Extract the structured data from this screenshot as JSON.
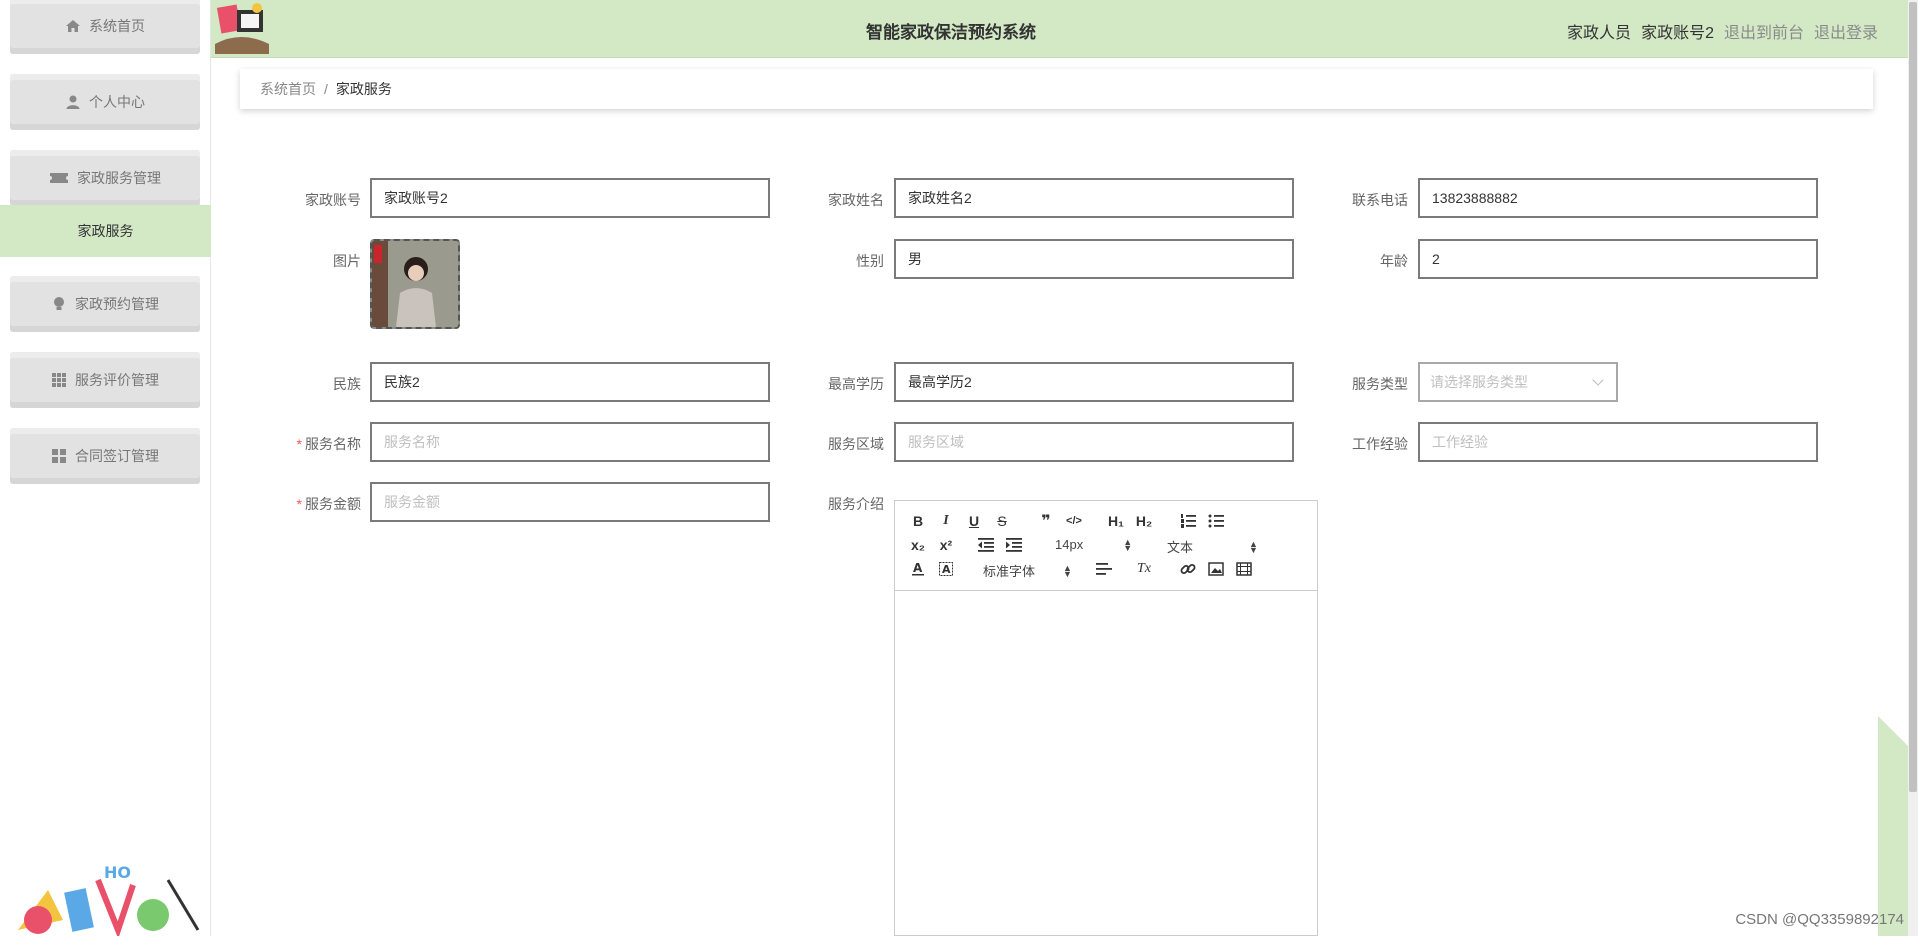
{
  "app": {
    "title": "智能家政保洁预约系统"
  },
  "header": {
    "role": "家政人员",
    "account": "家政账号2",
    "to_front": "退出到前台",
    "logout": "退出登录"
  },
  "sidebar": {
    "items": [
      {
        "label": "系统首页",
        "icon": "home-icon"
      },
      {
        "label": "个人中心",
        "icon": "user-icon"
      },
      {
        "label": "家政服务管理",
        "icon": "ticket-icon"
      },
      {
        "label": "家政预约管理",
        "icon": "bulb-icon"
      },
      {
        "label": "服务评价管理",
        "icon": "grid-icon"
      },
      {
        "label": "合同签订管理",
        "icon": "apps-icon"
      }
    ],
    "active_sub": "家政服务"
  },
  "breadcrumb": {
    "home": "系统首页",
    "sep": "/",
    "current": "家政服务"
  },
  "form": {
    "account": {
      "label": "家政账号",
      "value": "家政账号2"
    },
    "name": {
      "label": "家政姓名",
      "value": "家政姓名2"
    },
    "phone": {
      "label": "联系电话",
      "value": "13823888882"
    },
    "photo": {
      "label": "图片"
    },
    "gender": {
      "label": "性别",
      "value": "男"
    },
    "age": {
      "label": "年龄",
      "value": "2"
    },
    "ethnicity": {
      "label": "民族",
      "value": "民族2"
    },
    "education": {
      "label": "最高学历",
      "value": "最高学历2"
    },
    "service_type": {
      "label": "服务类型",
      "placeholder": "请选择服务类型"
    },
    "service_name": {
      "label": "服务名称",
      "placeholder": "服务名称",
      "required": "*"
    },
    "service_area": {
      "label": "服务区域",
      "placeholder": "服务区域"
    },
    "experience": {
      "label": "工作经验",
      "placeholder": "工作经验"
    },
    "service_price": {
      "label": "服务金额",
      "placeholder": "服务金额",
      "required": "*"
    },
    "intro": {
      "label": "服务介绍"
    }
  },
  "editor": {
    "bold": "B",
    "italic": "I",
    "underline": "U",
    "strike": "S",
    "quote": "❞",
    "code": "</>",
    "h1": "H₁",
    "h2": "H₂",
    "sub": "x₂",
    "sup": "x²",
    "size": "14px",
    "format": "文本",
    "font": "标准字体",
    "clean": "Tx"
  },
  "watermark": "CSDN @QQ3359892174",
  "colors": {
    "header_bg": "#d3e9c5",
    "active_sub_bg": "#d3e9c5",
    "menu_bg": "#e2e2e2"
  }
}
